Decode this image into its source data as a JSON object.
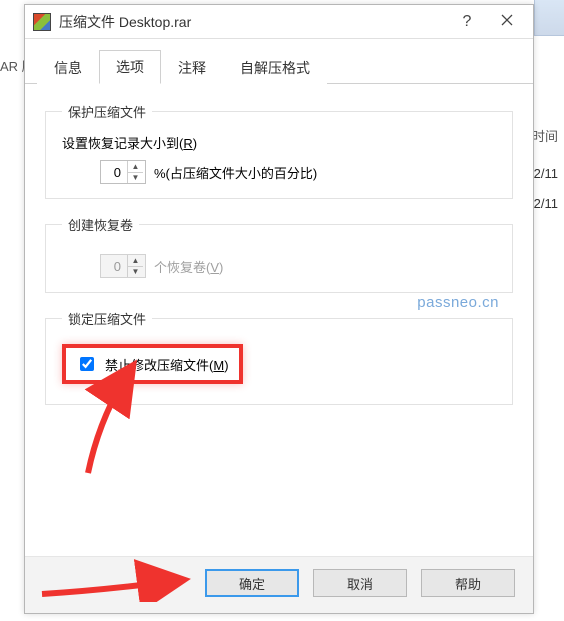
{
  "background": {
    "left_text": "AR 压",
    "time_header": "时间",
    "date1": "2/11",
    "date2": "2/11"
  },
  "titlebar": {
    "title": "压缩文件 Desktop.rar",
    "help_symbol": "?"
  },
  "tabs": {
    "info": "信息",
    "options": "选项",
    "comment": "注释",
    "sfx": "自解压格式"
  },
  "protect": {
    "legend": "保护压缩文件",
    "set_recovery_label_pre": "设置恢复记录大小到(",
    "set_recovery_hot": "R",
    "set_recovery_label_post": ")",
    "value": "0",
    "suffix": "%(占压缩文件大小的百分比)"
  },
  "recovery_volume": {
    "legend": "创建恢复卷",
    "value": "0",
    "suffix_pre": "个恢复卷(",
    "suffix_hot": "V",
    "suffix_post": ")"
  },
  "lock": {
    "legend": "锁定压缩文件",
    "checkbox_label_pre": "禁止修改压缩文件(",
    "checkbox_hot": "M",
    "checkbox_label_post": ")",
    "checked": true
  },
  "watermark": "passneo.cn",
  "buttons": {
    "ok": "确定",
    "cancel": "取消",
    "help": "帮助"
  }
}
